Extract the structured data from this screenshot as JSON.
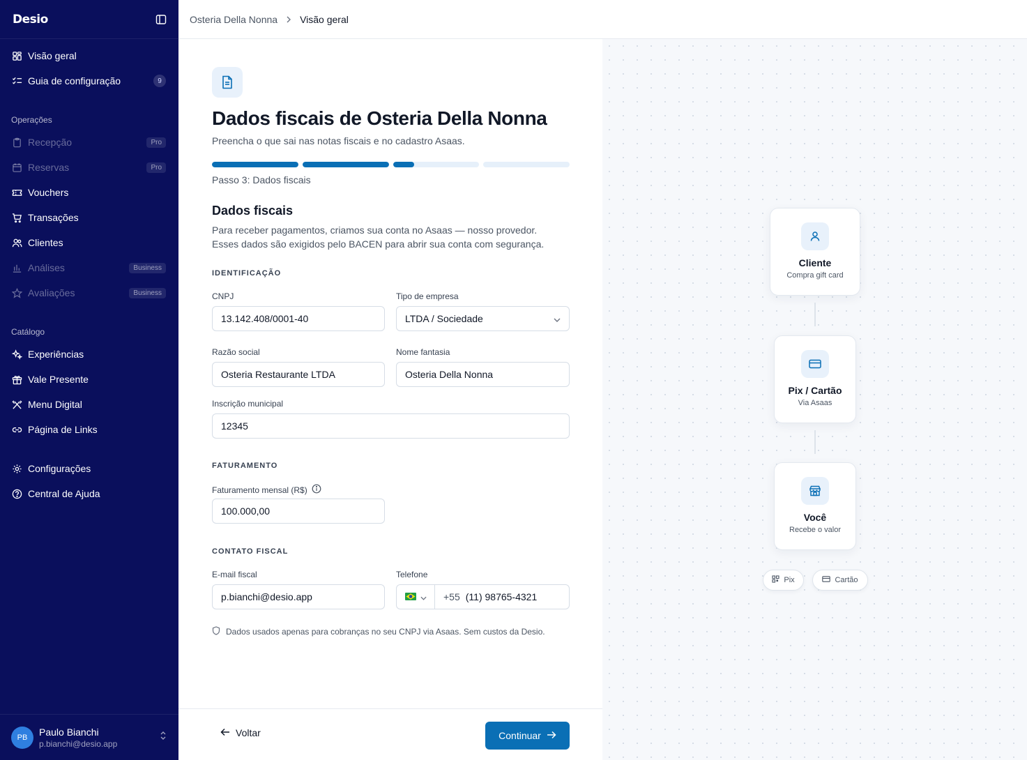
{
  "app": {
    "logo": "Desio"
  },
  "sidebar": {
    "items_top": [
      {
        "label": "Visão geral"
      },
      {
        "label": "Guia de configuração",
        "count": "9"
      }
    ],
    "section_operacoes": "Operações",
    "items_operacoes": [
      {
        "label": "Recepção",
        "badge": "Pro"
      },
      {
        "label": "Reservas",
        "badge": "Pro"
      },
      {
        "label": "Vouchers"
      },
      {
        "label": "Transações"
      },
      {
        "label": "Clientes"
      },
      {
        "label": "Análises",
        "badge": "Business"
      },
      {
        "label": "Avaliações",
        "badge": "Business"
      }
    ],
    "section_catalogo": "Catálogo",
    "items_catalogo": [
      {
        "label": "Experiências"
      },
      {
        "label": "Vale Presente"
      },
      {
        "label": "Menu Digital"
      },
      {
        "label": "Página de Links"
      }
    ],
    "items_bottom": [
      {
        "label": "Configurações"
      },
      {
        "label": "Central de Ajuda"
      }
    ],
    "user": {
      "initials": "PB",
      "name": "Paulo Bianchi",
      "email": "p.bianchi@desio.app"
    }
  },
  "breadcrumb": {
    "parent": "Osteria Della Nonna",
    "current": "Visão geral"
  },
  "form": {
    "title": "Dados fiscais de Osteria Della Nonna",
    "subtitle": "Preencha o que sai nas notas fiscais e no cadastro Asaas.",
    "progress": [
      1.0,
      1.0,
      0.25,
      0.0
    ],
    "step_label": "Passo 3: Dados fiscais",
    "section_title": "Dados fiscais",
    "description_1": "Para receber pagamentos, criamos sua conta no Asaas — nosso provedor.",
    "description_2": "Esses dados são exigidos pelo BACEN para abrir sua conta com segurança.",
    "cap_identificacao": "IDENTIFICAÇÃO",
    "cnpj_label": "CNPJ",
    "cnpj_value": "13.142.408/0001-40",
    "tipo_label": "Tipo de empresa",
    "tipo_value": "LTDA / Sociedade",
    "razao_label": "Razão social",
    "razao_value": "Osteria Restaurante LTDA",
    "fantasia_label": "Nome fantasia",
    "fantasia_value": "Osteria Della Nonna",
    "inscricao_label": "Inscrição municipal",
    "inscricao_value": "12345",
    "cap_faturamento": "FATURAMENTO",
    "fat_label": "Faturamento mensal (R$)",
    "fat_value": "100.000,00",
    "cap_contato": "CONTATO FISCAL",
    "email_label": "E-mail fiscal",
    "email_value": "p.bianchi@desio.app",
    "tel_label": "Telefone",
    "tel_cc": "+55",
    "tel_value": "(11) 98765-4321",
    "note": "Dados usados apenas para cobranças no seu CNPJ via Asaas. Sem custos da Desio.",
    "back_label": "Voltar",
    "continue_label": "Continuar"
  },
  "flow": {
    "cards": [
      {
        "title": "Cliente",
        "subtitle": "Compra gift card",
        "icon": "user-icon"
      },
      {
        "title": "Pix / Cartão",
        "subtitle": "Via Asaas",
        "icon": "card-icon"
      },
      {
        "title": "Você",
        "subtitle": "Recebe o valor",
        "icon": "store-icon"
      }
    ],
    "chips": [
      {
        "label": "Pix",
        "icon": "qr-icon"
      },
      {
        "label": "Cartão",
        "icon": "card-icon"
      }
    ]
  },
  "colors": {
    "sidebar": "#0a0f5c",
    "accent": "#0a6fb5",
    "accent_light": "#e8f1fb"
  }
}
